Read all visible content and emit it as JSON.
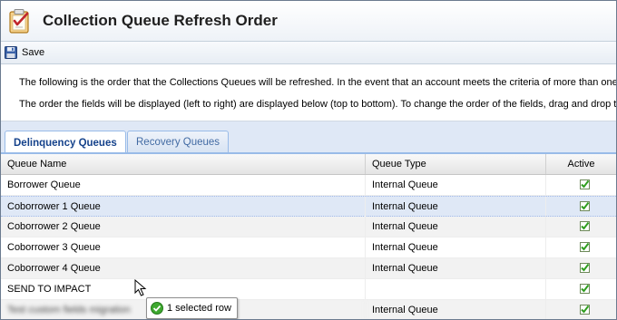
{
  "window": {
    "title": "Collection Queue Refresh Order",
    "title_icon": "checklist-icon"
  },
  "toolbar": {
    "save_label": "Save",
    "save_icon": "floppy-disk-icon"
  },
  "info": {
    "line1": "The following is the order that the Collections Queues will be refreshed. In the event that an account meets the criteria of more than one",
    "line2": "The order the fields will be displayed (left to right) are displayed below (top to bottom). To change the order of the fields, drag and drop t"
  },
  "tabs": [
    {
      "label": "Delinquency Queues",
      "active": true
    },
    {
      "label": "Recovery Queues",
      "active": false
    }
  ],
  "grid": {
    "columns": [
      "Queue Name",
      "Queue Type",
      "Active"
    ],
    "rows": [
      {
        "name": "Borrower Queue",
        "type": "Internal Queue",
        "active": true
      },
      {
        "name": "Coborrower 1 Queue",
        "type": "Internal Queue",
        "active": true
      },
      {
        "name": "Coborrower 2 Queue",
        "type": "Internal Queue",
        "active": true
      },
      {
        "name": "Coborrower 3 Queue",
        "type": "Internal Queue",
        "active": true
      },
      {
        "name": "Coborrower 4 Queue",
        "type": "Internal Queue",
        "active": true
      },
      {
        "name": "SEND TO IMPACT",
        "type": "",
        "active": true
      },
      {
        "name": "Test custom fields migration",
        "type": "Internal Queue",
        "active": true
      }
    ]
  },
  "drag": {
    "status": "1 selected row"
  },
  "colors": {
    "accent": "#15428b",
    "tab_border": "#99bbe8",
    "selected_row": "#dfe8f6",
    "check": "#2f9e1f"
  }
}
